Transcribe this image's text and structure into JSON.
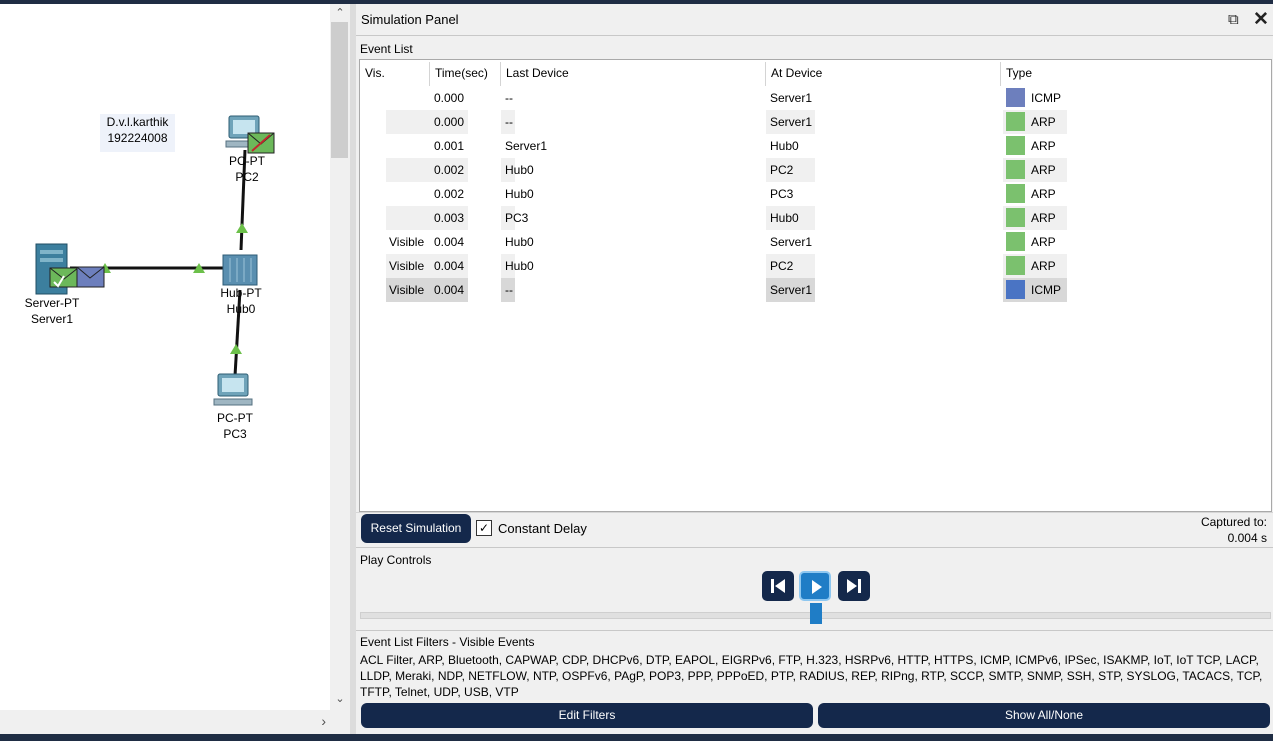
{
  "workspace": {
    "note": [
      "D.v.l.karthik",
      "192224008"
    ],
    "devices": {
      "pc2": {
        "type": "PC-PT",
        "name": "PC2"
      },
      "server1": {
        "type": "Server-PT",
        "name": "Server1"
      },
      "hub0": {
        "type": "Hub-PT",
        "name": "Hub0"
      },
      "pc3": {
        "type": "PC-PT",
        "name": "PC3"
      }
    }
  },
  "panel": {
    "title": "Simulation Panel",
    "restore_icon": "⧉",
    "close_icon": "✕",
    "event_list_label": "Event List",
    "columns": [
      "Vis.",
      "Time(sec)",
      "Last Device",
      "At Device",
      "Type"
    ],
    "events": [
      {
        "vis": "",
        "time": "0.000",
        "last": "--",
        "at": "Server1",
        "type": "ICMP",
        "color": "#6d7fbd"
      },
      {
        "vis": "",
        "time": "0.000",
        "last": "--",
        "at": "Server1",
        "type": "ARP",
        "color": "#7bc16e"
      },
      {
        "vis": "",
        "time": "0.001",
        "last": "Server1",
        "at": "Hub0",
        "type": "ARP",
        "color": "#7bc16e"
      },
      {
        "vis": "",
        "time": "0.002",
        "last": "Hub0",
        "at": "PC2",
        "type": "ARP",
        "color": "#7bc16e"
      },
      {
        "vis": "",
        "time": "0.002",
        "last": "Hub0",
        "at": "PC3",
        "type": "ARP",
        "color": "#7bc16e"
      },
      {
        "vis": "",
        "time": "0.003",
        "last": "PC3",
        "at": "Hub0",
        "type": "ARP",
        "color": "#7bc16e"
      },
      {
        "vis": "Visible",
        "time": "0.004",
        "last": "Hub0",
        "at": "Server1",
        "type": "ARP",
        "color": "#7bc16e"
      },
      {
        "vis": "Visible",
        "time": "0.004",
        "last": "Hub0",
        "at": "PC2",
        "type": "ARP",
        "color": "#7bc16e"
      },
      {
        "vis": "Visible",
        "time": "0.004",
        "last": "--",
        "at": "Server1",
        "type": "ICMP",
        "color": "#4a74c4"
      }
    ],
    "reset_label": "Reset Simulation",
    "constant_delay_label": "Constant Delay",
    "constant_delay_checked": true,
    "captured_label": "Captured to:",
    "captured_value": "0.004 s",
    "play_controls_label": "Play Controls",
    "filters_label": "Event List Filters - Visible Events",
    "filters_text": "ACL Filter, ARP, Bluetooth, CAPWAP, CDP, DHCPv6, DTP, EAPOL, EIGRPv6, FTP, H.323, HSRPv6, HTTP, HTTPS, ICMP, ICMPv6, IPSec, ISAKMP, IoT, IoT TCP, LACP, LLDP, Meraki, NDP, NETFLOW, NTP, OSPFv6, PAgP, POP3, PPP, PPPoED, PTP, RADIUS, REP, RIPng, RTP, SCCP, SMTP, SNMP, SSH, STP, SYSLOG, TACACS, TCP, TFTP, Telnet, UDP, USB, VTP",
    "edit_filters_label": "Edit Filters",
    "show_all_label": "Show All/None"
  },
  "colors": {
    "accent_dark": "#14284b",
    "accent_blue": "#1f7dc6",
    "arp": "#7bc16e",
    "icmp": "#6d7fbd"
  }
}
